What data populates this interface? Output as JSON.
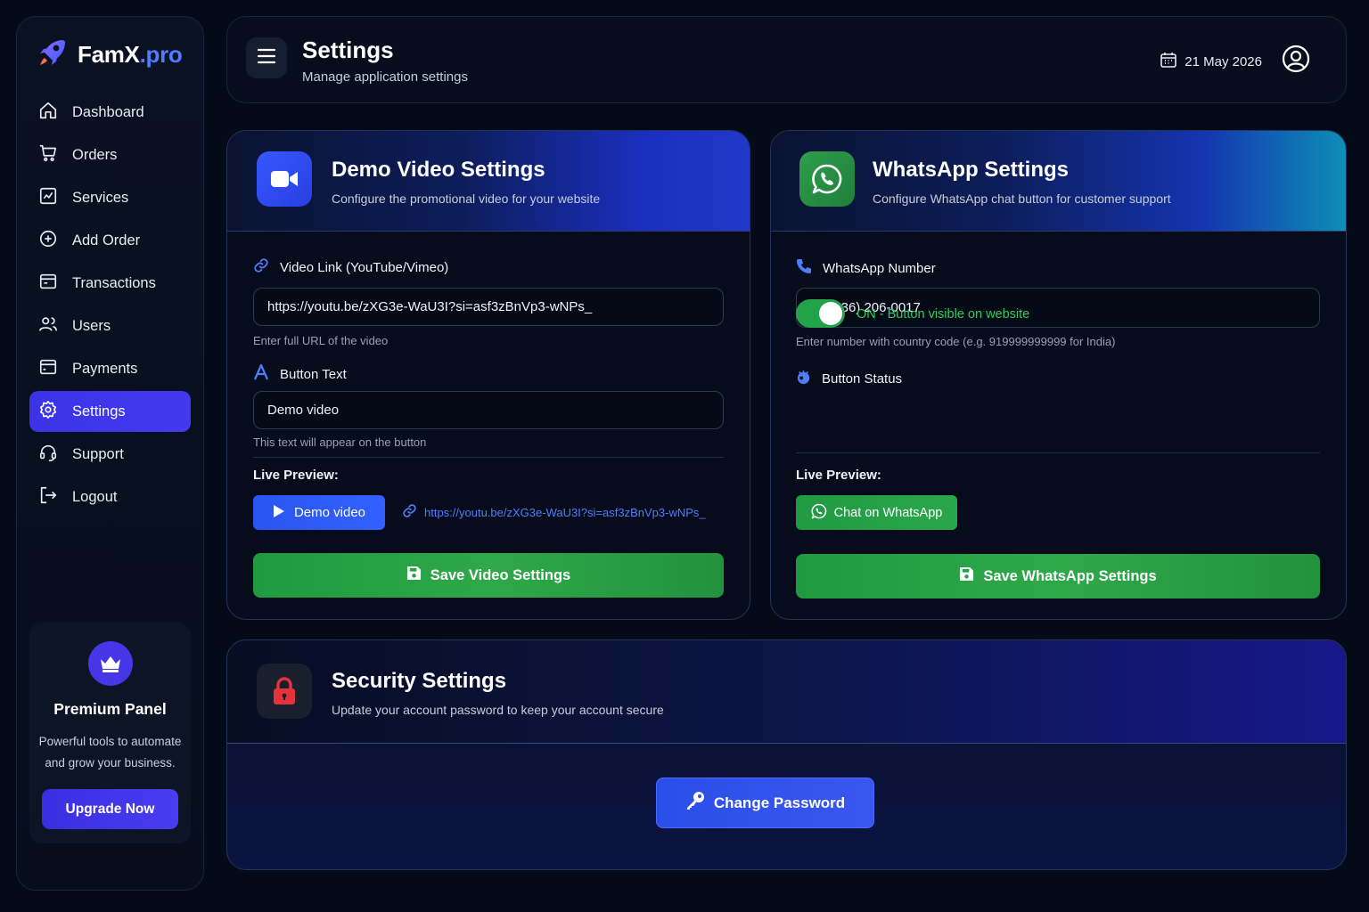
{
  "brand": {
    "name_main": "FamX",
    "name_accent": ".pro"
  },
  "sidebar": {
    "items": [
      {
        "label": "Dashboard",
        "icon": "home-icon"
      },
      {
        "label": "Orders",
        "icon": "cart-icon"
      },
      {
        "label": "Services",
        "icon": "chart-box-icon"
      },
      {
        "label": "Add Order",
        "icon": "plus-circle-icon"
      },
      {
        "label": "Transactions",
        "icon": "wallet-icon"
      },
      {
        "label": "Users",
        "icon": "users-icon"
      },
      {
        "label": "Payments",
        "icon": "card-icon"
      },
      {
        "label": "Settings",
        "icon": "gear-icon",
        "active": true
      },
      {
        "label": "Support",
        "icon": "headset-icon"
      },
      {
        "label": "Logout",
        "icon": "logout-icon"
      }
    ],
    "premium": {
      "title": "Premium Panel",
      "description": "Powerful tools to automate and grow your business.",
      "button": "Upgrade Now"
    }
  },
  "header": {
    "title": "Settings",
    "subtitle": "Manage application settings",
    "date": "21 May 2026"
  },
  "video_card": {
    "title": "Demo Video Settings",
    "subtitle": "Configure the promotional video for your website",
    "link_label": "Video Link (YouTube/Vimeo)",
    "link_value": "https://youtu.be/zXG3e-WaU3I?si=asf3zBnVp3-wNPs_",
    "link_hint": "Enter full URL of the video",
    "button_text_label": "Button Text",
    "button_text_value": "Demo video",
    "button_text_hint": "This text will appear on the button",
    "preview_label": "Live Preview:",
    "preview_button": "Demo video",
    "preview_link": "https://youtu.be/zXG3e-WaU3I?si=asf3zBnVp3-wNPs_",
    "save_button": "Save Video Settings"
  },
  "whatsapp_card": {
    "title": "WhatsApp Settings",
    "subtitle": "Configure WhatsApp chat button for customer support",
    "number_label": "WhatsApp Number",
    "number_value": "+1 (236) 206-0017",
    "number_hint": "Enter number with country code (e.g. 919999999999 for India)",
    "status_label": "Button Status",
    "status_text": "ON - Button visible on website",
    "status_on": true,
    "preview_label": "Live Preview:",
    "preview_button": "Chat on WhatsApp",
    "save_button": "Save WhatsApp Settings"
  },
  "security_card": {
    "title": "Security Settings",
    "subtitle": "Update your account password to keep your account secure",
    "button": "Change Password"
  },
  "colors": {
    "accent": "#4438f0",
    "brand_blue": "#4f7dff",
    "green": "#2fa84a",
    "danger": "#e5333b"
  }
}
